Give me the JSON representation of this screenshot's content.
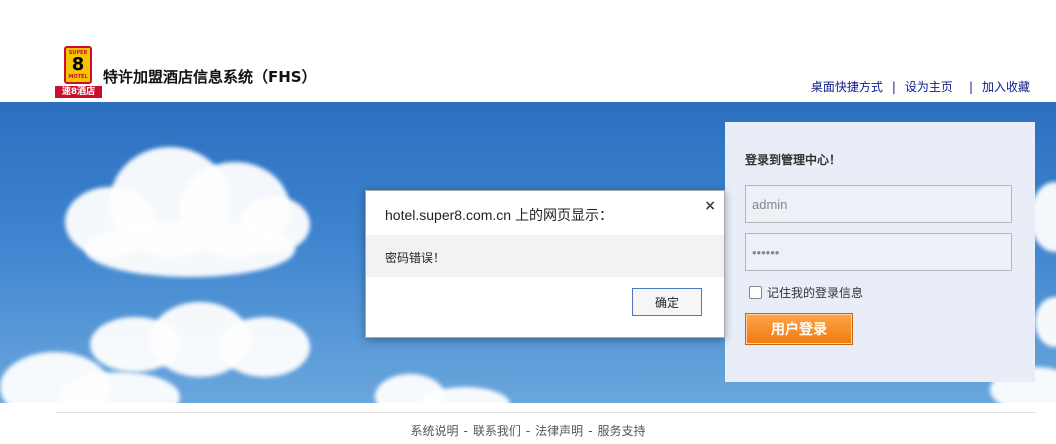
{
  "header": {
    "logo": {
      "badge_top": "SUPER",
      "badge_number": "8",
      "badge_bottom": "MOTEL",
      "cn_text": "速8酒店"
    },
    "app_title": "特许加盟酒店信息系统（FHS）",
    "links": [
      {
        "label": "桌面快捷方式"
      },
      {
        "label": "设为主页"
      },
      {
        "label": "加入收藏"
      }
    ],
    "link_separator": "|"
  },
  "login": {
    "title": "登录到管理中心！",
    "username_value": "admin",
    "password_value": "••••••",
    "remember_label": "记住我的登录信息",
    "remember_checked": false,
    "submit_label": "用户登录"
  },
  "dialog": {
    "title": "hotel.super8.com.cn 上的网页显示：",
    "message": "密码错误！",
    "ok_label": "确定",
    "close_glyph": "×"
  },
  "footer": {
    "links": [
      {
        "label": "系统说明"
      },
      {
        "label": "联系我们"
      },
      {
        "label": "法律声明"
      },
      {
        "label": "服务支持"
      }
    ],
    "separator": "-"
  },
  "colors": {
    "brand_red": "#c8102e",
    "brand_yellow": "#f5c400",
    "sky_blue": "#3e84cf",
    "login_button": "#f07a10",
    "link_blue": "#0b1c8c"
  }
}
